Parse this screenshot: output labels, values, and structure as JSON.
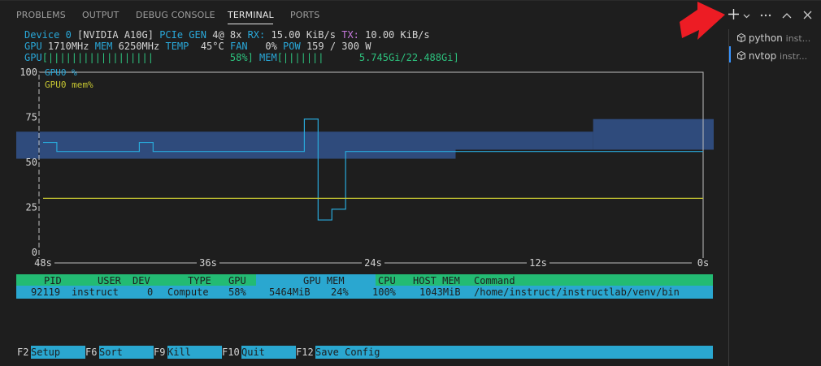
{
  "panel_tabs": {
    "problems": "PROBLEMS",
    "output": "OUTPUT",
    "debug_console": "DEBUG CONSOLE",
    "terminal": "TERMINAL",
    "ports": "PORTS"
  },
  "toolbar": {
    "new_terminal_icon": "plus-icon",
    "dropdown_icon": "chevron-down-icon",
    "more_icon": "ellipsis-icon",
    "maximize_icon": "chevron-up-icon",
    "close_icon": "close-icon",
    "red_arrow": "arrow-annotation"
  },
  "sessions": [
    {
      "name": "python",
      "detail": "inst...",
      "active": false
    },
    {
      "name": "nvtop",
      "detail": "instr...",
      "active": true
    }
  ],
  "nvtop": {
    "device": {
      "label": "Device 0",
      "name": "[NVIDIA A10G]",
      "pcie_label": "PCIe GEN",
      "pcie_value": "4@ 8x",
      "rx_label": "RX:",
      "rx_value": "15.00 KiB/s",
      "tx_label": "TX:",
      "tx_value": "10.00 KiB/s"
    },
    "clocks": {
      "gpu_label": "GPU",
      "gpu_value": "1710MHz",
      "mem_label": "MEM",
      "mem_value": "6250MHz",
      "temp_label": "TEMP",
      "temp_value": " 45°C",
      "fan_label": "FAN",
      "fan_value": "  0%",
      "pow_label": "POW",
      "pow_value": "159 / 300 W"
    },
    "bars": {
      "gpu_label": "GPU",
      "gpu_bar": "[||||||||||||||||||             58%]",
      "mem_label": "MEM",
      "mem_bar": "[|||||||      5.745Gi/22.488Gi]",
      "gpu_util": 0.58,
      "mem_fraction": 0.255
    },
    "columns": [
      "PID",
      "USER",
      "DEV",
      "TYPE",
      "GPU",
      "GPU MEM",
      "CPU",
      "HOST MEM",
      "Command"
    ],
    "process": {
      "pid": "92119",
      "user": "instruct",
      "dev": "0",
      "type": "Compute",
      "gpu": "58%",
      "gpu_mem": "5464MiB",
      "gpu_mem_pct": "24%",
      "cpu": "100%",
      "host_mem": "1043MiB",
      "command": "/home/instruct/instructlab/venv/bin"
    },
    "function_keys": [
      {
        "key": "F2",
        "label": "Setup"
      },
      {
        "key": "F6",
        "label": "Sort"
      },
      {
        "key": "F9",
        "label": "Kill"
      },
      {
        "key": "F10",
        "label": "Quit"
      },
      {
        "key": "F12",
        "label": "Save Config"
      }
    ]
  },
  "chart_data": {
    "type": "line",
    "series": [
      {
        "name": "GPU0 %",
        "color": "#29a8d9",
        "x": [
          -48,
          -47,
          -46,
          -45,
          -44,
          -43,
          -42,
          -41,
          -40,
          -39,
          -38,
          -37,
          -36,
          -35,
          -34,
          -33,
          -32,
          -31,
          -30,
          -29,
          -28,
          -27,
          -26,
          -25,
          -24,
          -23,
          -22,
          -21,
          -20,
          -19,
          -18,
          -17,
          -16,
          -15,
          -14,
          -13,
          -12,
          -11,
          -10,
          -9,
          -8,
          -7,
          -6,
          -5,
          -4,
          -3,
          -2,
          -1,
          0
        ],
        "values": [
          61,
          56,
          56,
          56,
          56,
          56,
          56,
          61,
          56,
          56,
          56,
          56,
          56,
          56,
          56,
          56,
          56,
          56,
          56,
          74,
          18,
          24,
          56,
          56,
          56,
          56,
          56,
          56,
          56,
          56,
          56,
          56,
          56,
          56,
          56,
          56,
          56,
          56,
          56,
          56,
          56,
          56,
          56,
          56,
          56,
          56,
          56,
          56,
          56
        ]
      },
      {
        "name": "GPU0 mem%",
        "color": "#c8c832",
        "x": [
          -48,
          0
        ],
        "values": [
          30,
          30
        ]
      }
    ],
    "band": {
      "color": "#2f4b7c",
      "segments": [
        {
          "from": -48,
          "to": -18,
          "low": 52,
          "high": 67
        },
        {
          "from": -18,
          "to": -8,
          "low": 57,
          "high": 67
        },
        {
          "from": -8,
          "to": 0,
          "low": 57,
          "high": 74
        }
      ]
    },
    "yticks": [
      "0",
      "25",
      "50",
      "75",
      "100"
    ],
    "xticks": [
      "48s",
      "36s",
      "24s",
      "12s",
      "0s"
    ],
    "ylim": [
      0,
      100
    ],
    "xlim": [
      -48,
      0
    ],
    "legend": "top-left"
  }
}
